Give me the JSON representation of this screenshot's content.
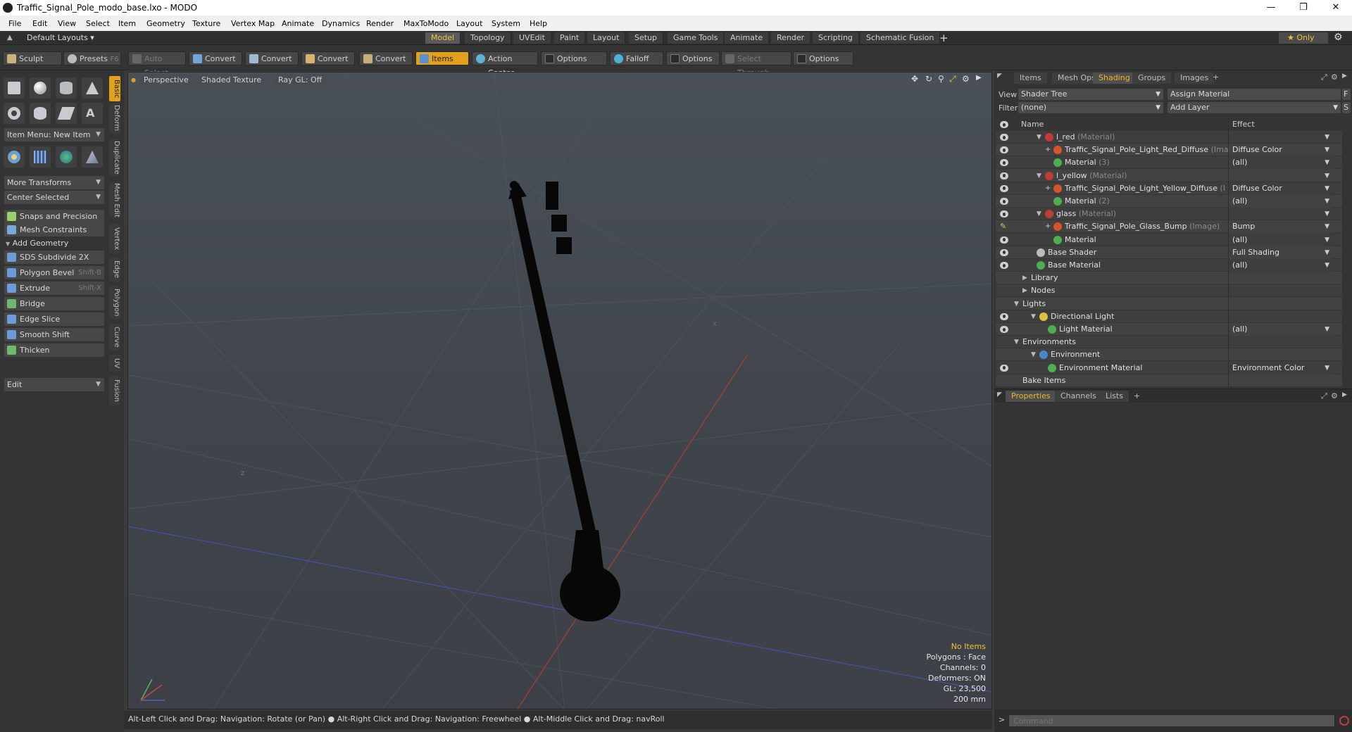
{
  "window": {
    "title": "Traffic_Signal_Pole_modo_base.lxo - MODO",
    "minimize": "—",
    "maximize": "❒",
    "close": "✕"
  },
  "menu": [
    "File",
    "Edit",
    "View",
    "Select",
    "Item",
    "Geometry",
    "Texture",
    "Vertex Map",
    "Animate",
    "Dynamics",
    "Render",
    "MaxToModo",
    "Layout",
    "System",
    "Help"
  ],
  "layouts": {
    "default_label": "Default Layouts ▾",
    "tabs": [
      "Model",
      "Topology",
      "UVEdit",
      "Paint",
      "Layout",
      "Setup",
      "Game Tools",
      "Animate",
      "Render",
      "Scripting",
      "Schematic Fusion"
    ],
    "active": "Model",
    "add": "+",
    "only": "★  Only",
    "gear": "⚙"
  },
  "toolbar": {
    "sculpt": "Sculpt",
    "presets": "Presets",
    "presets_key": "F6",
    "auto_select": "Auto Select",
    "convert1": "Convert",
    "convert2": "Convert",
    "convert3": "Convert",
    "convert4": "Convert",
    "items": "Items",
    "action_center": "Action Center",
    "options1": "Options",
    "falloff": "Falloff",
    "options2": "Options",
    "select_through": "Select Through",
    "options3": "Options"
  },
  "left": {
    "item_menu": "Item Menu: New Item",
    "more_transforms": "More Transforms",
    "center_selected": "Center Selected",
    "snaps": "Snaps and Precision",
    "mesh_constraints": "Mesh Constraints",
    "add_geometry": "Add Geometry",
    "tools": [
      {
        "label": "SDS Subdivide 2X",
        "key": ""
      },
      {
        "label": "Polygon Bevel",
        "key": "Shift-B"
      },
      {
        "label": "Extrude",
        "key": "Shift-X"
      },
      {
        "label": "Bridge",
        "key": ""
      },
      {
        "label": "Edge Slice",
        "key": ""
      },
      {
        "label": "Smooth Shift",
        "key": ""
      },
      {
        "label": "Thicken",
        "key": ""
      }
    ],
    "edit": "Edit",
    "vtabs": [
      "Basic",
      "Deform",
      "Duplicate",
      "Mesh Edit",
      "Vertex",
      "Edge",
      "Polygon",
      "Curve",
      "UV",
      "Fusion"
    ]
  },
  "viewport": {
    "perspective": "Perspective",
    "shaded_texture": "Shaded Texture",
    "ray_gl": "Ray GL: Off",
    "info": {
      "no_items": "No Items",
      "polygons": "Polygons : Face",
      "channels": "Channels: 0",
      "deformers": "Deformers: ON",
      "gl": "GL: 23,500",
      "scale": "200 mm"
    },
    "x_label": "x",
    "z_label": "z"
  },
  "status": "Alt-Left Click and Drag: Navigation: Rotate (or Pan) ●  Alt-Right Click and Drag: Navigation: Freewheel ●  Alt-Middle Click and Drag: navRoll",
  "right": {
    "tabs": [
      "Items",
      "Mesh Ops",
      "Shading",
      "Groups",
      "Images"
    ],
    "active_tab": "Shading",
    "add": "+",
    "view_label": "View",
    "view_value": "Shader Tree",
    "assign_material": "Assign Material",
    "f_btn": "F",
    "filter_label": "Filter",
    "filter_value": "(none)",
    "add_layer": "Add Layer",
    "s_btn": "S",
    "col_name": "Name",
    "col_effect": "Effect",
    "rows": [
      {
        "name": "l_red",
        "sub": "(Material)",
        "effect": "",
        "icon": "#c23a3a",
        "indent": 70,
        "vis": "eye",
        "arrow": "▼"
      },
      {
        "name": "Traffic_Signal_Pole_Light_Red_Diffuse",
        "sub": "(Ima",
        "effect": "Diffuse Color",
        "icon": "#d4552a",
        "indent": 82,
        "vis": "eye",
        "arrow": "+"
      },
      {
        "name": "Material",
        "sub": "(3)",
        "effect": "(all)",
        "icon": "#4fae4f",
        "indent": 82,
        "vis": "eye",
        "arrow": ""
      },
      {
        "name": "l_yellow",
        "sub": "(Material)",
        "effect": "",
        "icon": "#c23a3a",
        "indent": 70,
        "vis": "eye",
        "arrow": "▼"
      },
      {
        "name": "Traffic_Signal_Pole_Light_Yellow_Diffuse",
        "sub": "(I",
        "effect": "Diffuse Color",
        "icon": "#d4552a",
        "indent": 82,
        "vis": "eye",
        "arrow": "+"
      },
      {
        "name": "Material",
        "sub": "(2)",
        "effect": "(all)",
        "icon": "#4fae4f",
        "indent": 82,
        "vis": "eye",
        "arrow": ""
      },
      {
        "name": "glass",
        "sub": "(Material)",
        "effect": "",
        "icon": "#c23a3a",
        "indent": 70,
        "vis": "eye",
        "arrow": "▼"
      },
      {
        "name": "Traffic_Signal_Pole_Glass_Bump",
        "sub": "(Image)",
        "effect": "Bump",
        "icon": "#d4552a",
        "indent": 82,
        "vis": "brush",
        "arrow": "+"
      },
      {
        "name": "Material",
        "sub": "",
        "effect": "(all)",
        "icon": "#4fae4f",
        "indent": 82,
        "vis": "eye",
        "arrow": ""
      },
      {
        "name": "Base Shader",
        "sub": "",
        "effect": "Full Shading",
        "icon": "#bbbbbb",
        "indent": 58,
        "vis": "eye",
        "arrow": ""
      },
      {
        "name": "Base Material",
        "sub": "",
        "effect": "(all)",
        "icon": "#4fae4f",
        "indent": 58,
        "vis": "eye",
        "arrow": ""
      },
      {
        "name": "Library",
        "sub": "",
        "effect": "",
        "icon": "",
        "indent": 50,
        "vis": "",
        "arrow": "▶"
      },
      {
        "name": "Nodes",
        "sub": "",
        "effect": "",
        "icon": "",
        "indent": 50,
        "vis": "",
        "arrow": "▶"
      },
      {
        "name": "Lights",
        "sub": "",
        "effect": "",
        "icon": "",
        "indent": 38,
        "vis": "",
        "arrow": "▼"
      },
      {
        "name": "Directional Light",
        "sub": "",
        "effect": "",
        "icon": "#e0c040",
        "indent": 62,
        "vis": "eye",
        "arrow": "▼"
      },
      {
        "name": "Light Material",
        "sub": "",
        "effect": "(all)",
        "icon": "#4fae4f",
        "indent": 74,
        "vis": "eye",
        "arrow": ""
      },
      {
        "name": "Environments",
        "sub": "",
        "effect": "",
        "icon": "",
        "indent": 38,
        "vis": "",
        "arrow": "▼"
      },
      {
        "name": "Environment",
        "sub": "",
        "effect": "",
        "icon": "#4a86d0",
        "indent": 62,
        "vis": "",
        "arrow": "▼"
      },
      {
        "name": "Environment Material",
        "sub": "",
        "effect": "Environment Color",
        "icon": "#4fae4f",
        "indent": 74,
        "vis": "eye",
        "arrow": ""
      },
      {
        "name": "Bake Items",
        "sub": "",
        "effect": "",
        "icon": "",
        "indent": 38,
        "vis": "",
        "arrow": ""
      }
    ],
    "prop_tabs": [
      "Properties",
      "Channels",
      "Lists"
    ],
    "prop_active": "Properties",
    "command_placeholder": "Command",
    "cmd_arrow": ">"
  },
  "colors": {
    "accent": "#e2a11a",
    "active_text": "#f0b429",
    "background": "#3b3b3b"
  },
  "icons": [
    "search-icon",
    "gear-icon",
    "eye-icon",
    "brush-icon",
    "move-icon",
    "rotate-icon",
    "zoom-icon"
  ]
}
